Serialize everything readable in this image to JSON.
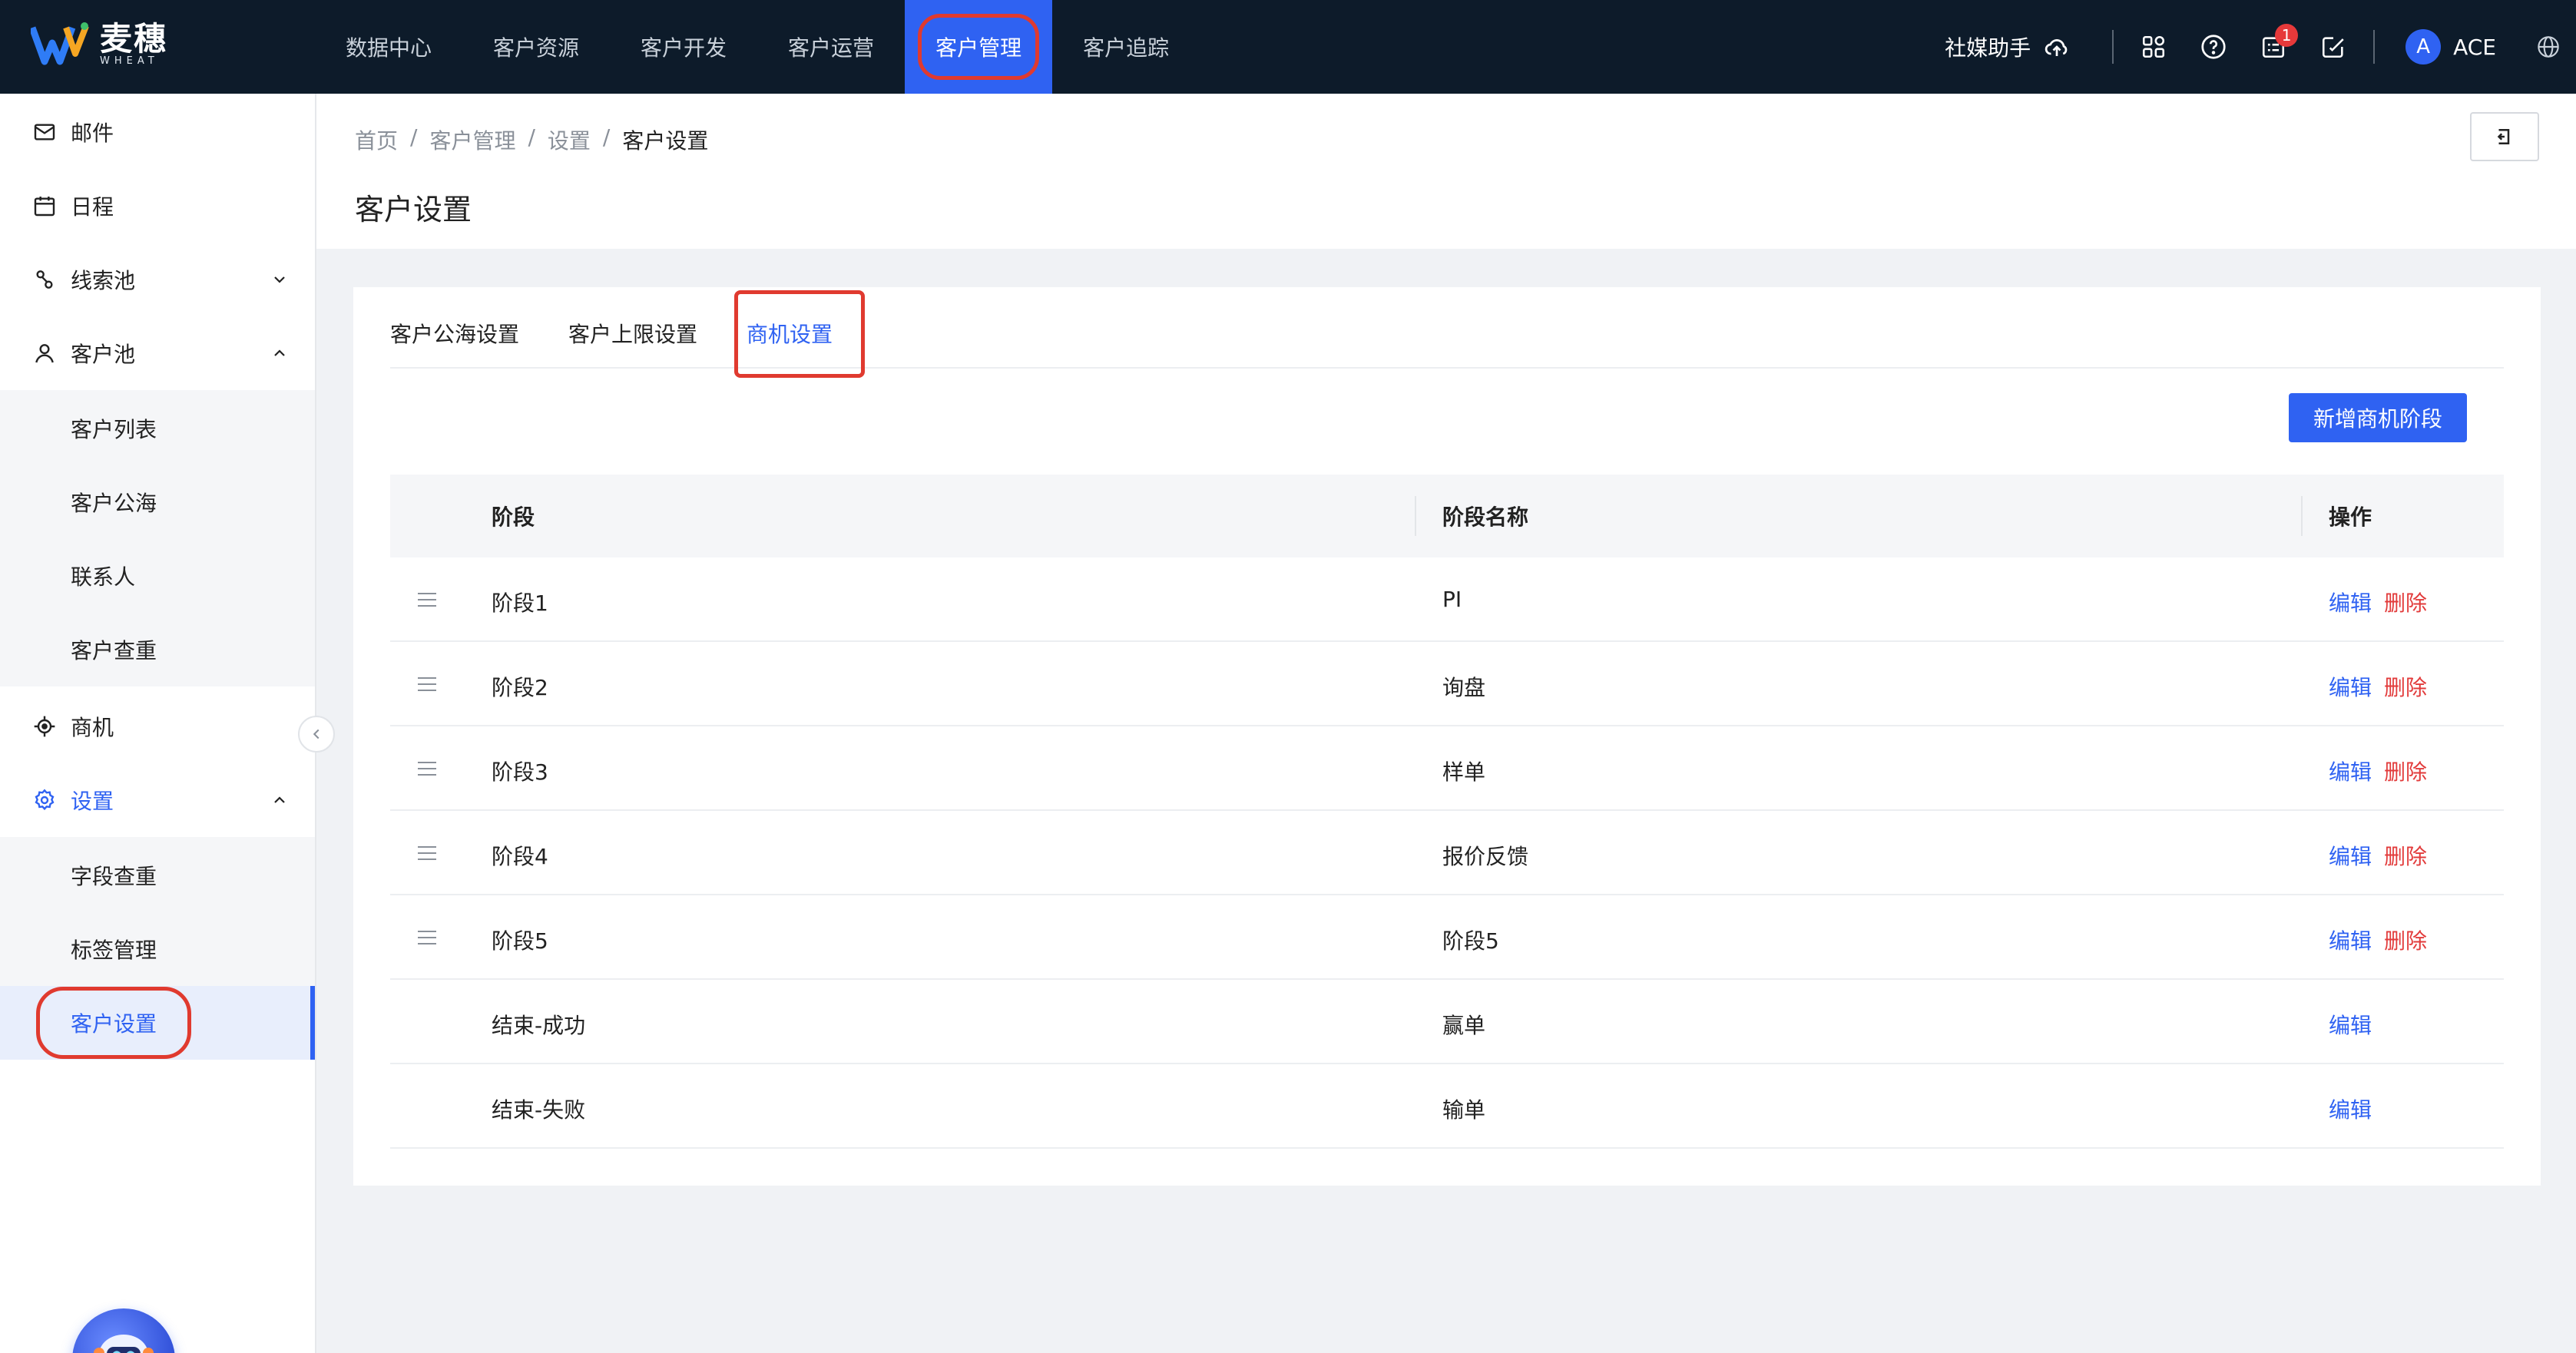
{
  "app": {
    "logo_cn": "麦穗",
    "logo_en": "WHEAT"
  },
  "topnav": {
    "items": [
      {
        "label": "数据中心"
      },
      {
        "label": "客户资源"
      },
      {
        "label": "客户开发"
      },
      {
        "label": "客户运营"
      },
      {
        "label": "客户管理",
        "active": true
      },
      {
        "label": "客户追踪"
      }
    ],
    "social_assistant": "社媒助手",
    "notification_count": "1",
    "avatar_letter": "A",
    "user_name": "ACE"
  },
  "sidebar": {
    "mail": "邮件",
    "schedule": "日程",
    "leads_pool": "线索池",
    "customer_pool": "客户池",
    "customer_pool_children": [
      "客户列表",
      "客户公海",
      "联系人",
      "客户查重"
    ],
    "opportunity": "商机",
    "settings": "设置",
    "settings_children": [
      "字段查重",
      "标签管理",
      "客户设置"
    ]
  },
  "breadcrumb": [
    "首页",
    "客户管理",
    "设置",
    "客户设置"
  ],
  "page_title": "客户设置",
  "tabs": [
    "客户公海设置",
    "客户上限设置",
    "商机设置"
  ],
  "active_tab": "商机设置",
  "add_button": "新增商机阶段",
  "table": {
    "headers": [
      "阶段",
      "阶段名称",
      "操作"
    ],
    "rows": [
      {
        "stage": "阶段1",
        "name": "PI",
        "edit": "编辑",
        "delete": "删除",
        "draggable": true
      },
      {
        "stage": "阶段2",
        "name": "询盘",
        "edit": "编辑",
        "delete": "删除",
        "draggable": true
      },
      {
        "stage": "阶段3",
        "name": "样单",
        "edit": "编辑",
        "delete": "删除",
        "draggable": true
      },
      {
        "stage": "阶段4",
        "name": "报价反馈",
        "edit": "编辑",
        "delete": "删除",
        "draggable": true
      },
      {
        "stage": "阶段5",
        "name": "阶段5",
        "edit": "编辑",
        "delete": "删除",
        "draggable": true
      },
      {
        "stage": "结束-成功",
        "name": "赢单",
        "edit": "编辑",
        "delete": "",
        "draggable": false
      },
      {
        "stage": "结束-失败",
        "name": "输单",
        "edit": "编辑",
        "delete": "",
        "draggable": false
      }
    ]
  },
  "colors": {
    "topbar": "#0d1b2a",
    "primary": "#2f62f2",
    "danger": "#e23b3b",
    "highlight": "#e03a2f"
  }
}
